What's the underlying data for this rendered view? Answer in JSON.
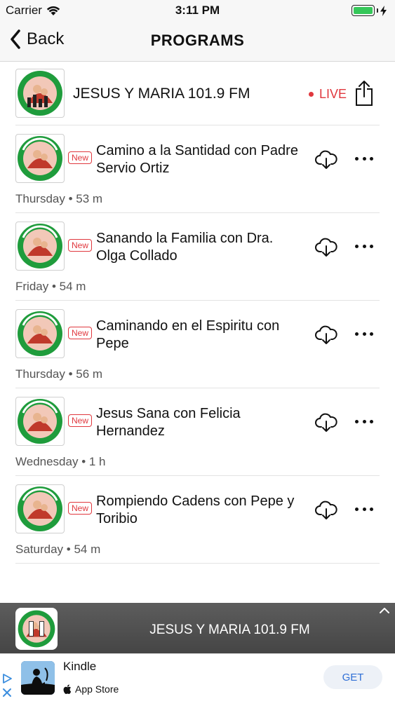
{
  "status_bar": {
    "carrier": "Carrier",
    "time": "3:11 PM",
    "wifi_icon": "wifi-icon",
    "battery_icon": "battery-icon",
    "battery_level": 1.0,
    "charging_icon": "bolt-icon"
  },
  "nav": {
    "back_label": "Back",
    "title": "PROGRAMS"
  },
  "live": {
    "station_name": "JESUS Y MARIA 101.9 FM",
    "live_label": "LIVE",
    "share_icon": "share-icon"
  },
  "episodes": [
    {
      "badge": "New",
      "title": "Camino a la Santidad con Padre Servio Ortiz",
      "meta": "Thursday • 53 m"
    },
    {
      "badge": "New",
      "title": "Sanando la Familia con Dra. Olga Collado",
      "meta": "Friday • 54 m"
    },
    {
      "badge": "New",
      "title": "Caminando en el Espiritu con Pepe",
      "meta": "Thursday • 56 m"
    },
    {
      "badge": "New",
      "title": "Jesus Sana con Felicia Hernandez",
      "meta": "Wednesday • 1 h"
    },
    {
      "badge": "New",
      "title": "Rompiendo Cadens con Pepe y Toribio",
      "meta": "Saturday • 54 m"
    }
  ],
  "player": {
    "title": "JESUS Y MARIA 101.9 FM",
    "state_icon": "pause-icon"
  },
  "ad": {
    "app_name": "Kindle",
    "store": "App Store",
    "cta": "GET"
  },
  "colors": {
    "accent_red": "#e0383e",
    "logo_green": "#1f9c3c",
    "get_blue": "#2f6fd6",
    "player_bg": "#4f4f4f"
  }
}
